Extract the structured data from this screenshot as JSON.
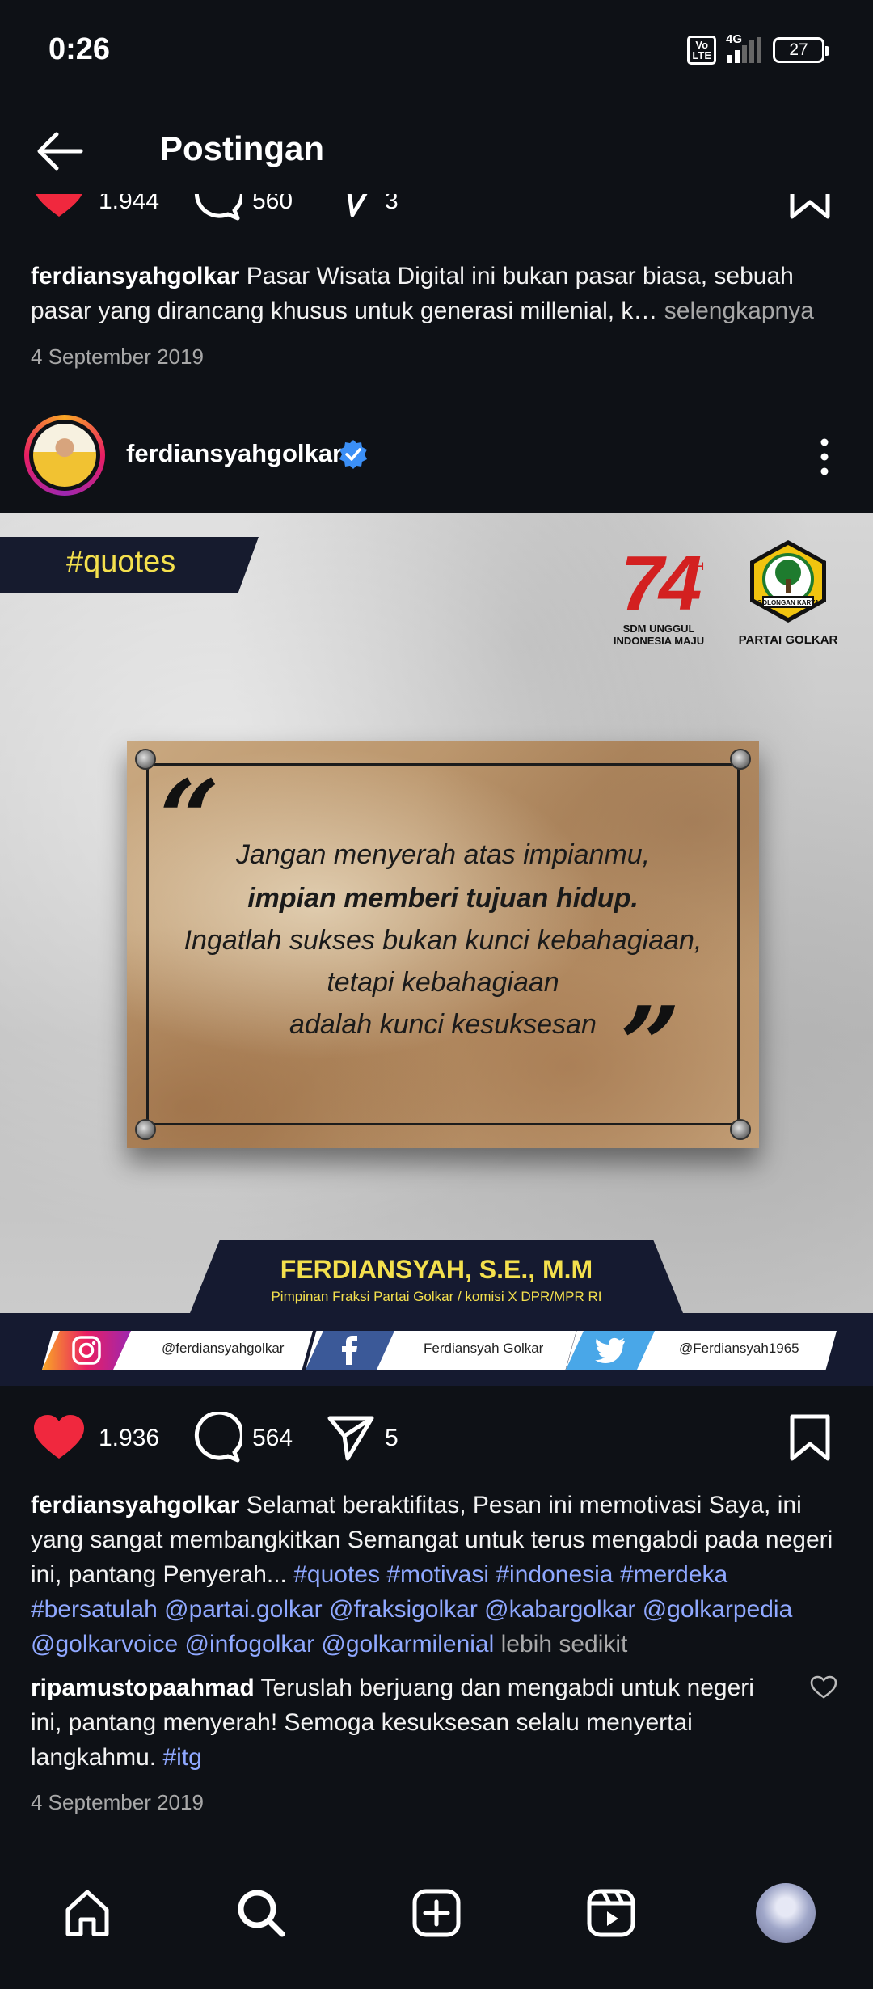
{
  "status_bar": {
    "time": "0:26",
    "volte": "Vo\nLTE",
    "network": "4G",
    "battery": "27"
  },
  "header": {
    "title": "Postingan"
  },
  "previous_post": {
    "likes": "1.944",
    "comments": "560",
    "shares": "3",
    "caption_user": "ferdiansyahgolkar",
    "caption_text": " Pasar Wisata Digital ini bukan pasar biasa, sebuah pasar yang dirancang khusus untuk generasi millenial, k…",
    "more_label": " selengkapnya",
    "date": "4 September 2019"
  },
  "post": {
    "username": "ferdiansyahgolkar",
    "image": {
      "quotes_label": "#quotes",
      "hut_number": "74",
      "hut_tm": "TH",
      "hut_line1": "SDM UNGGUL",
      "hut_line2": "INDONESIA MAJU",
      "golkar_label": "PARTAI GOLKAR",
      "golkar_ribbon": "GOLONGAN KARYA",
      "quote_lines": [
        "Jangan menyerah atas impianmu,",
        "impian memberi tujuan hidup.",
        "Ingatlah sukses bukan kunci kebahagiaan,",
        "tetapi kebahagiaan",
        "adalah kunci kesuksesan"
      ],
      "name": "FERDIANSYAH, S.E., M.M",
      "subtitle": "Pimpinan Fraksi Partai Golkar / komisi X DPR/MPR RI",
      "socials": [
        {
          "icon": "instagram-icon",
          "label": "@ferdiansyahgolkar"
        },
        {
          "icon": "facebook-icon",
          "label": "Ferdiansyah Golkar"
        },
        {
          "icon": "twitter-icon",
          "label": "@Ferdiansyah1965"
        }
      ]
    },
    "likes": "1.936",
    "comments": "564",
    "shares": "5",
    "caption_user": "ferdiansyahgolkar",
    "caption_text": " Selamat beraktifitas, Pesan ini memotivasi Saya, ini yang sangat membangkitkan Semangat untuk terus mengabdi pada negeri ini, pantang Penyerah... ",
    "caption_tags": "#quotes  #motivasi #indonesia #merdeka #bersatulah  @partai.golkar @fraksigolkar @kabargolkar @golkarpedia @golkarvoice @infogolkar @golkarmilenial",
    "less_label": " lebih sedikit",
    "comment": {
      "user": "ripamustopaahmad",
      "text": " Teruslah berjuang dan mengabdi untuk negeri ini, pantang menyerah! Semoga kesuksesan selalu menyertai langkahmu. ",
      "tag": "#itg"
    },
    "date": "4 September 2019"
  },
  "colors": {
    "background": "#0e1116",
    "like_red": "#f0283e",
    "tag_blue": "#8fa8ff",
    "verified_blue": "#3b8ff6"
  },
  "nav": [
    "home-icon",
    "search-icon",
    "create-icon",
    "reels-icon",
    "profile-avatar"
  ]
}
